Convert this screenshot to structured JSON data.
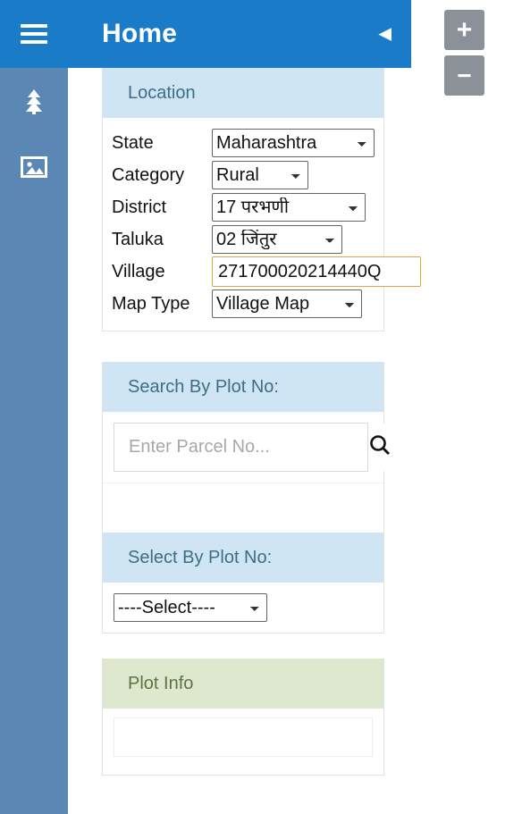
{
  "window": {
    "background": "#ffffff"
  },
  "rail": {
    "menu_icon": "hamburger-icon",
    "items": [
      {
        "icon": "tree-icon",
        "name": "layers-tree"
      },
      {
        "icon": "image-icon",
        "name": "basemap-gallery"
      }
    ]
  },
  "header": {
    "title": "Home",
    "collapse_icon": "◀",
    "accent": "#1a7bc9"
  },
  "zoom": {
    "in_label": "+",
    "out_label": "−",
    "button_color": "#8a9199"
  },
  "location": {
    "title": "Location",
    "header_bg": "#cfe5f3",
    "fields": [
      {
        "label": "State",
        "value": "Maharashtra"
      },
      {
        "label": "Category",
        "value": "Rural"
      },
      {
        "label": "District",
        "value": "17 परभणी"
      },
      {
        "label": "Taluka",
        "value": "02 जिंतुर"
      },
      {
        "label": "Village",
        "value": "271700020214440Q"
      },
      {
        "label": "Map Type",
        "value": "Village Map"
      }
    ],
    "village_highlight": "#d8a93b"
  },
  "search_by_plot": {
    "title": "Search By Plot No:",
    "placeholder": "Enter Parcel No...",
    "value": "",
    "search_icon": "search-icon"
  },
  "select_by_plot": {
    "title": "Select By Plot No:",
    "value": "----Select----"
  },
  "plot_info": {
    "title": "Plot Info",
    "header_bg": "#dde8cf",
    "content": ""
  }
}
